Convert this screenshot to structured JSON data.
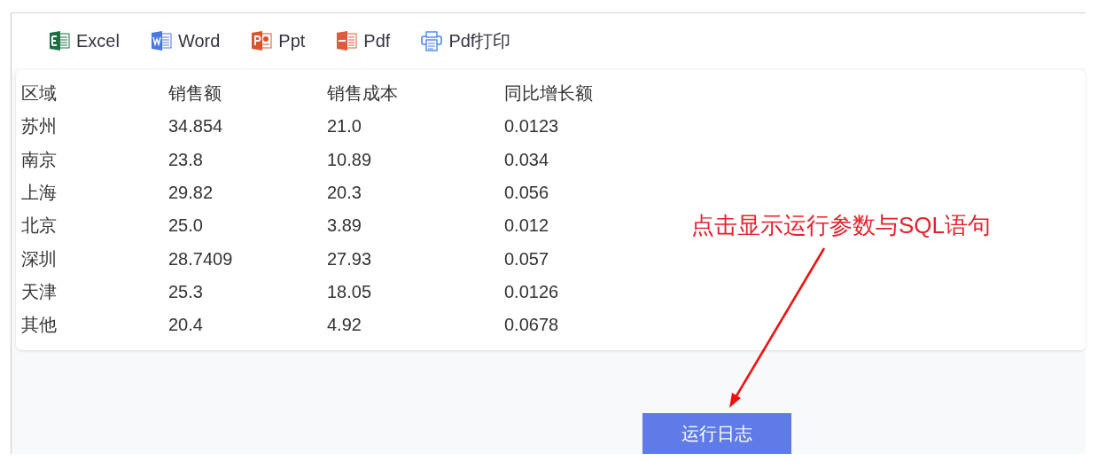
{
  "toolbar": {
    "items": [
      {
        "kind": "excel",
        "label": "Excel"
      },
      {
        "kind": "word",
        "label": "Word"
      },
      {
        "kind": "ppt",
        "label": "Ppt"
      },
      {
        "kind": "pdf",
        "label": "Pdf"
      },
      {
        "kind": "print",
        "label": "Pdf打印"
      }
    ]
  },
  "table": {
    "columns": [
      "区域",
      "销售额",
      "销售成本",
      "同比增长额"
    ],
    "rows": [
      [
        "苏州",
        "34.854",
        "21.0",
        "0.0123"
      ],
      [
        "南京",
        "23.8",
        "10.89",
        "0.034"
      ],
      [
        "上海",
        "29.82",
        "20.3",
        "0.056"
      ],
      [
        "北京",
        "25.0",
        "3.89",
        "0.012"
      ],
      [
        "深圳",
        "28.7409",
        "27.93",
        "0.057"
      ],
      [
        "天津",
        "25.3",
        "18.05",
        "0.0126"
      ],
      [
        "其他",
        "20.4",
        "4.92",
        "0.0678"
      ]
    ]
  },
  "annotation": {
    "text": "点击显示运行参数与SQL语句"
  },
  "run_log_button": {
    "label": "运行日志"
  }
}
